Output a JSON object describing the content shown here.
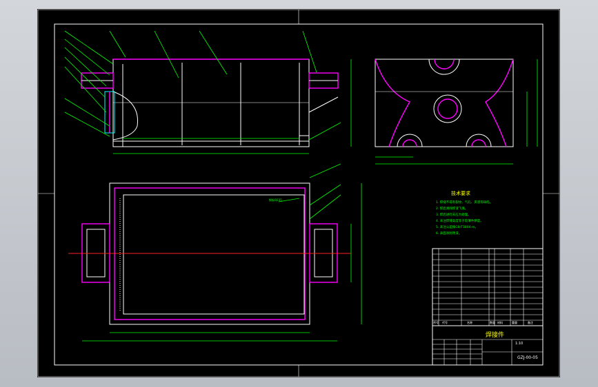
{
  "drawing": {
    "title_block": {
      "name": "焊接件",
      "drawing_no": "GZJ-00-05",
      "scale": "1:10"
    },
    "tech_requirements": {
      "title": "技术要求",
      "items": [
        "1. 焊缝不得有裂纹、气孔、夹渣等缺陷。",
        "2. 焊后清除焊渣飞溅。",
        "3. 焊后进行去应力处理。",
        "4. 未注焊缝高度等于较薄件厚度。",
        "5. 未注公差按GB/T1804-m。",
        "6. 表面涂防锈漆。"
      ]
    },
    "bom_headers": [
      "序号",
      "代号",
      "名称",
      "数量",
      "材料",
      "重量",
      "备注"
    ],
    "notes": [
      "钢板Q235"
    ],
    "colors": {
      "background": "#000000",
      "outline": "#ffffff",
      "dimension": "#00ff00",
      "weld": "#ff00ff",
      "centerline": "#ff2020",
      "label": "#ffff00"
    }
  }
}
